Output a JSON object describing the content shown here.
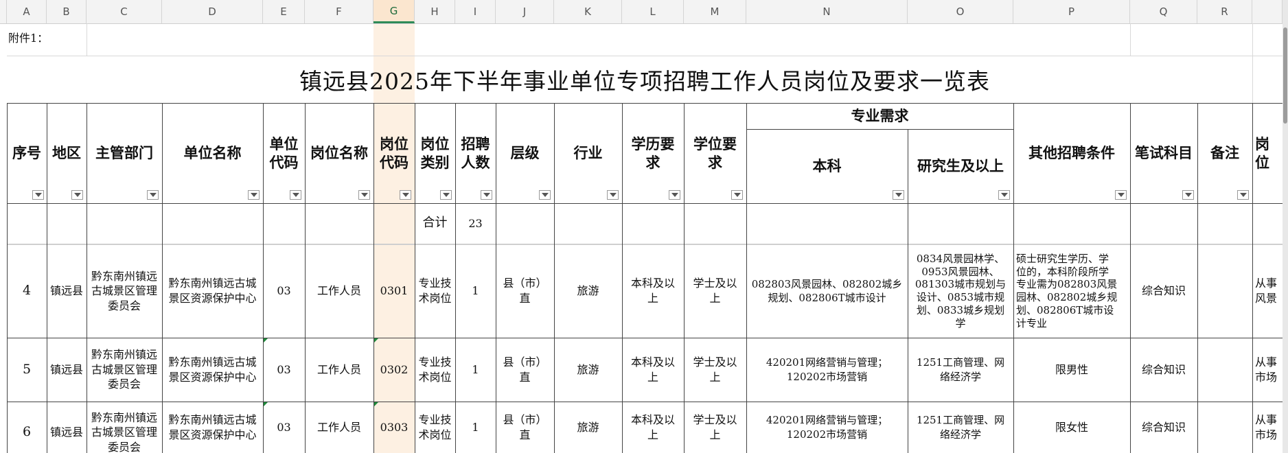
{
  "columns": [
    "A",
    "B",
    "C",
    "D",
    "E",
    "F",
    "G",
    "H",
    "I",
    "J",
    "K",
    "L",
    "M",
    "N",
    "O",
    "P",
    "Q",
    "R",
    ""
  ],
  "attachment_label": "附件1：",
  "title": "镇远县2025年下半年事业单位专项招聘工作人员岗位及要求一览表",
  "headers": {
    "seq": "序号",
    "region": "地区",
    "dept": "主管部门",
    "unit": "单位名称",
    "unit_code_l1": "单位",
    "unit_code_l2": "代码",
    "post_name": "岗位名称",
    "post_code_l1": "岗位",
    "post_code_l2": "代码",
    "post_type_l1": "岗位",
    "post_type_l2": "类别",
    "hire_l1": "招聘",
    "hire_l2": "人数",
    "level": "层级",
    "industry": "行业",
    "edu_l1": "学历要",
    "edu_l2": "求",
    "degree_l1": "学位要",
    "degree_l2": "求",
    "major": "专业需求",
    "bachelor": "本科",
    "graduate": "研究生及以上",
    "other": "其他招聘条件",
    "exam": "笔试科目",
    "remark": "备注",
    "extra": "岗位"
  },
  "total": {
    "label": "合计",
    "value": "23"
  },
  "rows": [
    {
      "seq": "4",
      "region": "镇远县",
      "dept_l1": "黔东南州镇远",
      "dept_l2": "古城景区管理",
      "dept_l3": "委员会",
      "unit_l1": "黔东南州镇远古城",
      "unit_l2": "景区资源保护中心",
      "unit_code": "03",
      "post_name": "工作人员",
      "post_code": "0301",
      "post_type_l1": "专业技",
      "post_type_l2": "术岗位",
      "hire": "1",
      "level_l1": "县（市）",
      "level_l2": "直",
      "industry": "旅游",
      "edu_l1": "本科及以",
      "edu_l2": "上",
      "degree_l1": "学士及以",
      "degree_l2": "上",
      "bachelor_l1": "082803风景园林、082802城乡",
      "bachelor_l2": "规划、082806T城市设计",
      "graduate_l1": "0834风景园林学、",
      "graduate_l2": "0953风景园林、",
      "graduate_l3": "081303城市规划与",
      "graduate_l4": "设计、0853城市规",
      "graduate_l5": "划、0833城乡规划",
      "graduate_l6": "学",
      "other_l1": "硕士研究生学历、学",
      "other_l2": "位的，本科阶段所学",
      "other_l3": "专业需为082803风景",
      "other_l4": "园林、082802城乡规",
      "other_l5": "划、082806T城市设",
      "other_l6": "计专业",
      "exam": "综合知识",
      "extra_l1": "从事",
      "extra_l2": "风景"
    },
    {
      "seq": "5",
      "region": "镇远县",
      "dept_l1": "黔东南州镇远",
      "dept_l2": "古城景区管理",
      "dept_l3": "委员会",
      "unit_l1": "黔东南州镇远古城",
      "unit_l2": "景区资源保护中心",
      "unit_code": "03",
      "post_name": "工作人员",
      "post_code": "0302",
      "post_type_l1": "专业技",
      "post_type_l2": "术岗位",
      "hire": "1",
      "level_l1": "县（市）",
      "level_l2": "直",
      "industry": "旅游",
      "edu_l1": "本科及以",
      "edu_l2": "上",
      "degree_l1": "学士及以",
      "degree_l2": "上",
      "bachelor_l1": "420201网络营销与管理；",
      "bachelor_l2": "120202市场营销",
      "graduate_l1": "1251工商管理、网",
      "graduate_l2": "络经济学",
      "other": "限男性",
      "exam": "综合知识",
      "extra_l1": "从事",
      "extra_l2": "市场"
    },
    {
      "seq": "6",
      "region": "镇远县",
      "dept_l1": "黔东南州镇远",
      "dept_l2": "古城景区管理",
      "dept_l3": "委员会",
      "unit_l1": "黔东南州镇远古城",
      "unit_l2": "景区资源保护中心",
      "unit_code": "03",
      "post_name": "工作人员",
      "post_code": "0303",
      "post_type_l1": "专业技",
      "post_type_l2": "术岗位",
      "hire": "1",
      "level_l1": "县（市）",
      "level_l2": "直",
      "industry": "旅游",
      "edu_l1": "本科及以",
      "edu_l2": "上",
      "degree_l1": "学士及以",
      "degree_l2": "上",
      "bachelor_l1": "420201网络营销与管理；",
      "bachelor_l2": "120202市场营销",
      "graduate_l1": "1251工商管理、网",
      "graduate_l2": "络经济学",
      "other": "限女性",
      "exam": "综合知识",
      "extra_l1": "从事",
      "extra_l2": "市场"
    }
  ]
}
